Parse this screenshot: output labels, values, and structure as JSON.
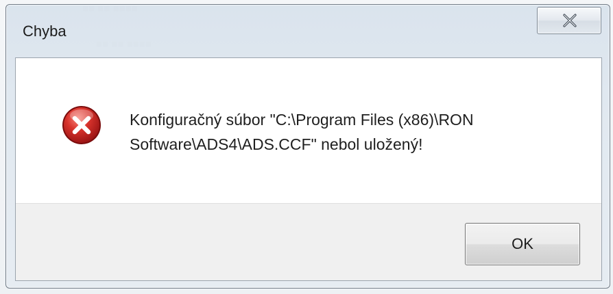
{
  "dialog": {
    "title": "Chyba",
    "close_icon": "close-icon",
    "message_line1": "Konfiguračný súbor \"C:\\Program Files (x86)\\RON",
    "message_line2": "Software\\ADS4\\ADS.CCF\" nebol uložený!",
    "icon": "error-icon",
    "ok_label": "OK"
  },
  "colors": {
    "error_red": "#d42a2a",
    "frame": "#d8e2ec",
    "button_area": "#f0f0f0"
  }
}
